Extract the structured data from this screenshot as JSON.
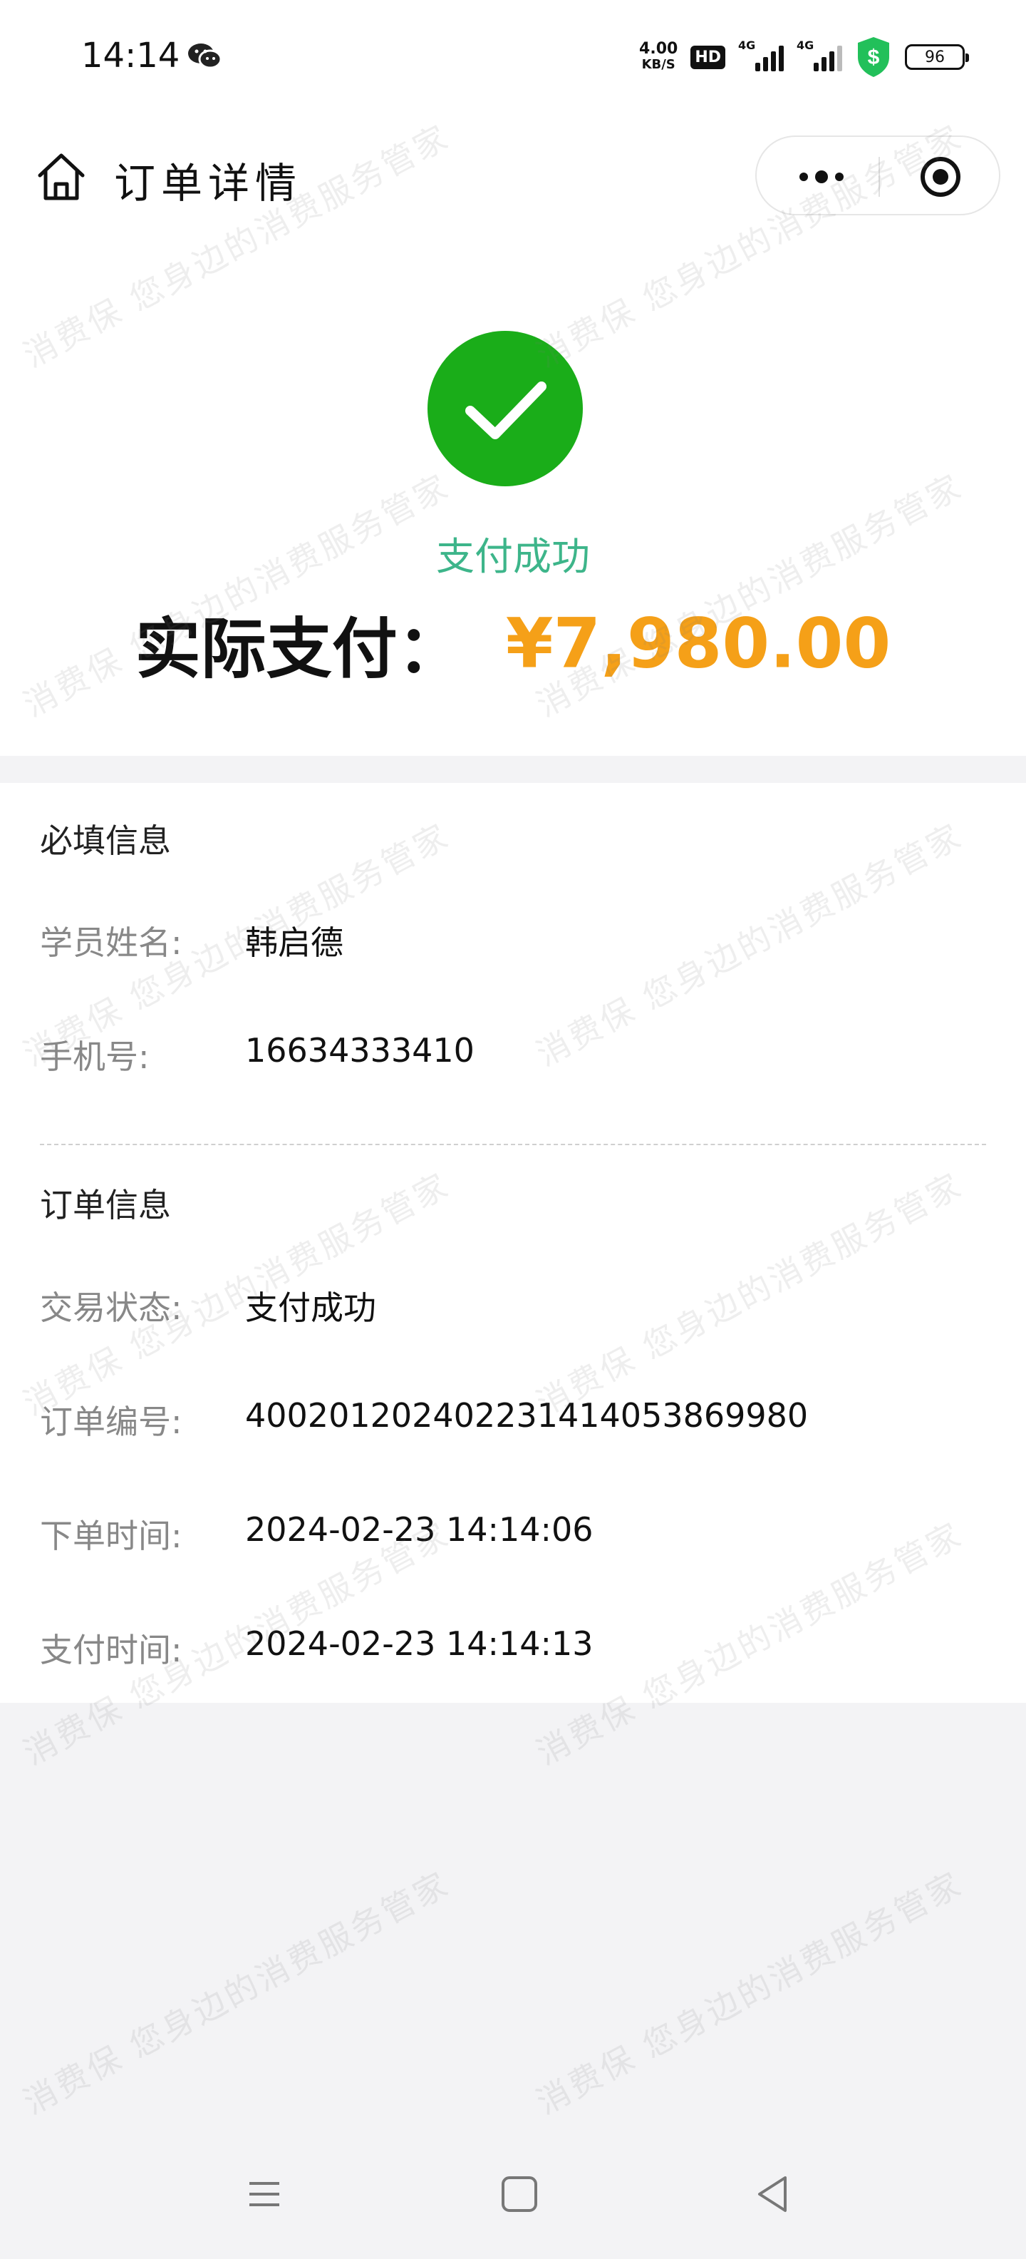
{
  "status_bar": {
    "time": "14:14",
    "net_speed_value": "4.00",
    "net_speed_unit": "KB/S",
    "hd_label": "HD",
    "signal1_tag": "4G",
    "signal2_tag": "4G",
    "battery": "96"
  },
  "nav": {
    "title": "订单详情"
  },
  "hero": {
    "status_text": "支付成功",
    "pay_label": "实际支付：",
    "pay_amount": "¥7,980.00",
    "success_color": "#1aad19"
  },
  "required_info": {
    "title": "必填信息",
    "rows": [
      {
        "label": "学员姓名:",
        "value": "韩启德"
      },
      {
        "label": "手机号:",
        "value": "16634333410"
      }
    ]
  },
  "order_info": {
    "title": "订单信息",
    "rows": [
      {
        "label": "交易状态:",
        "value": "支付成功"
      },
      {
        "label": "订单编号:",
        "value": "4002012024022314140538699​80"
      },
      {
        "label": "下单时间:",
        "value": "2024-02-23 14:14:06"
      },
      {
        "label": "支付时间:",
        "value": "2024-02-23 14:14:13"
      }
    ]
  },
  "watermark": {
    "line_a": "消费保 您身边的消费服务管家",
    "line_b": "消费保 您身边的消费服务管家"
  },
  "icons": {
    "home": "home-icon",
    "more": "more-icon",
    "close": "close-icon",
    "success": "checkmark-circle-icon",
    "menu": "menu-icon",
    "square": "home-square-icon",
    "back": "back-triangle-icon"
  },
  "colors": {
    "accent_amount": "#f5a018",
    "status_green": "#3db58a"
  }
}
